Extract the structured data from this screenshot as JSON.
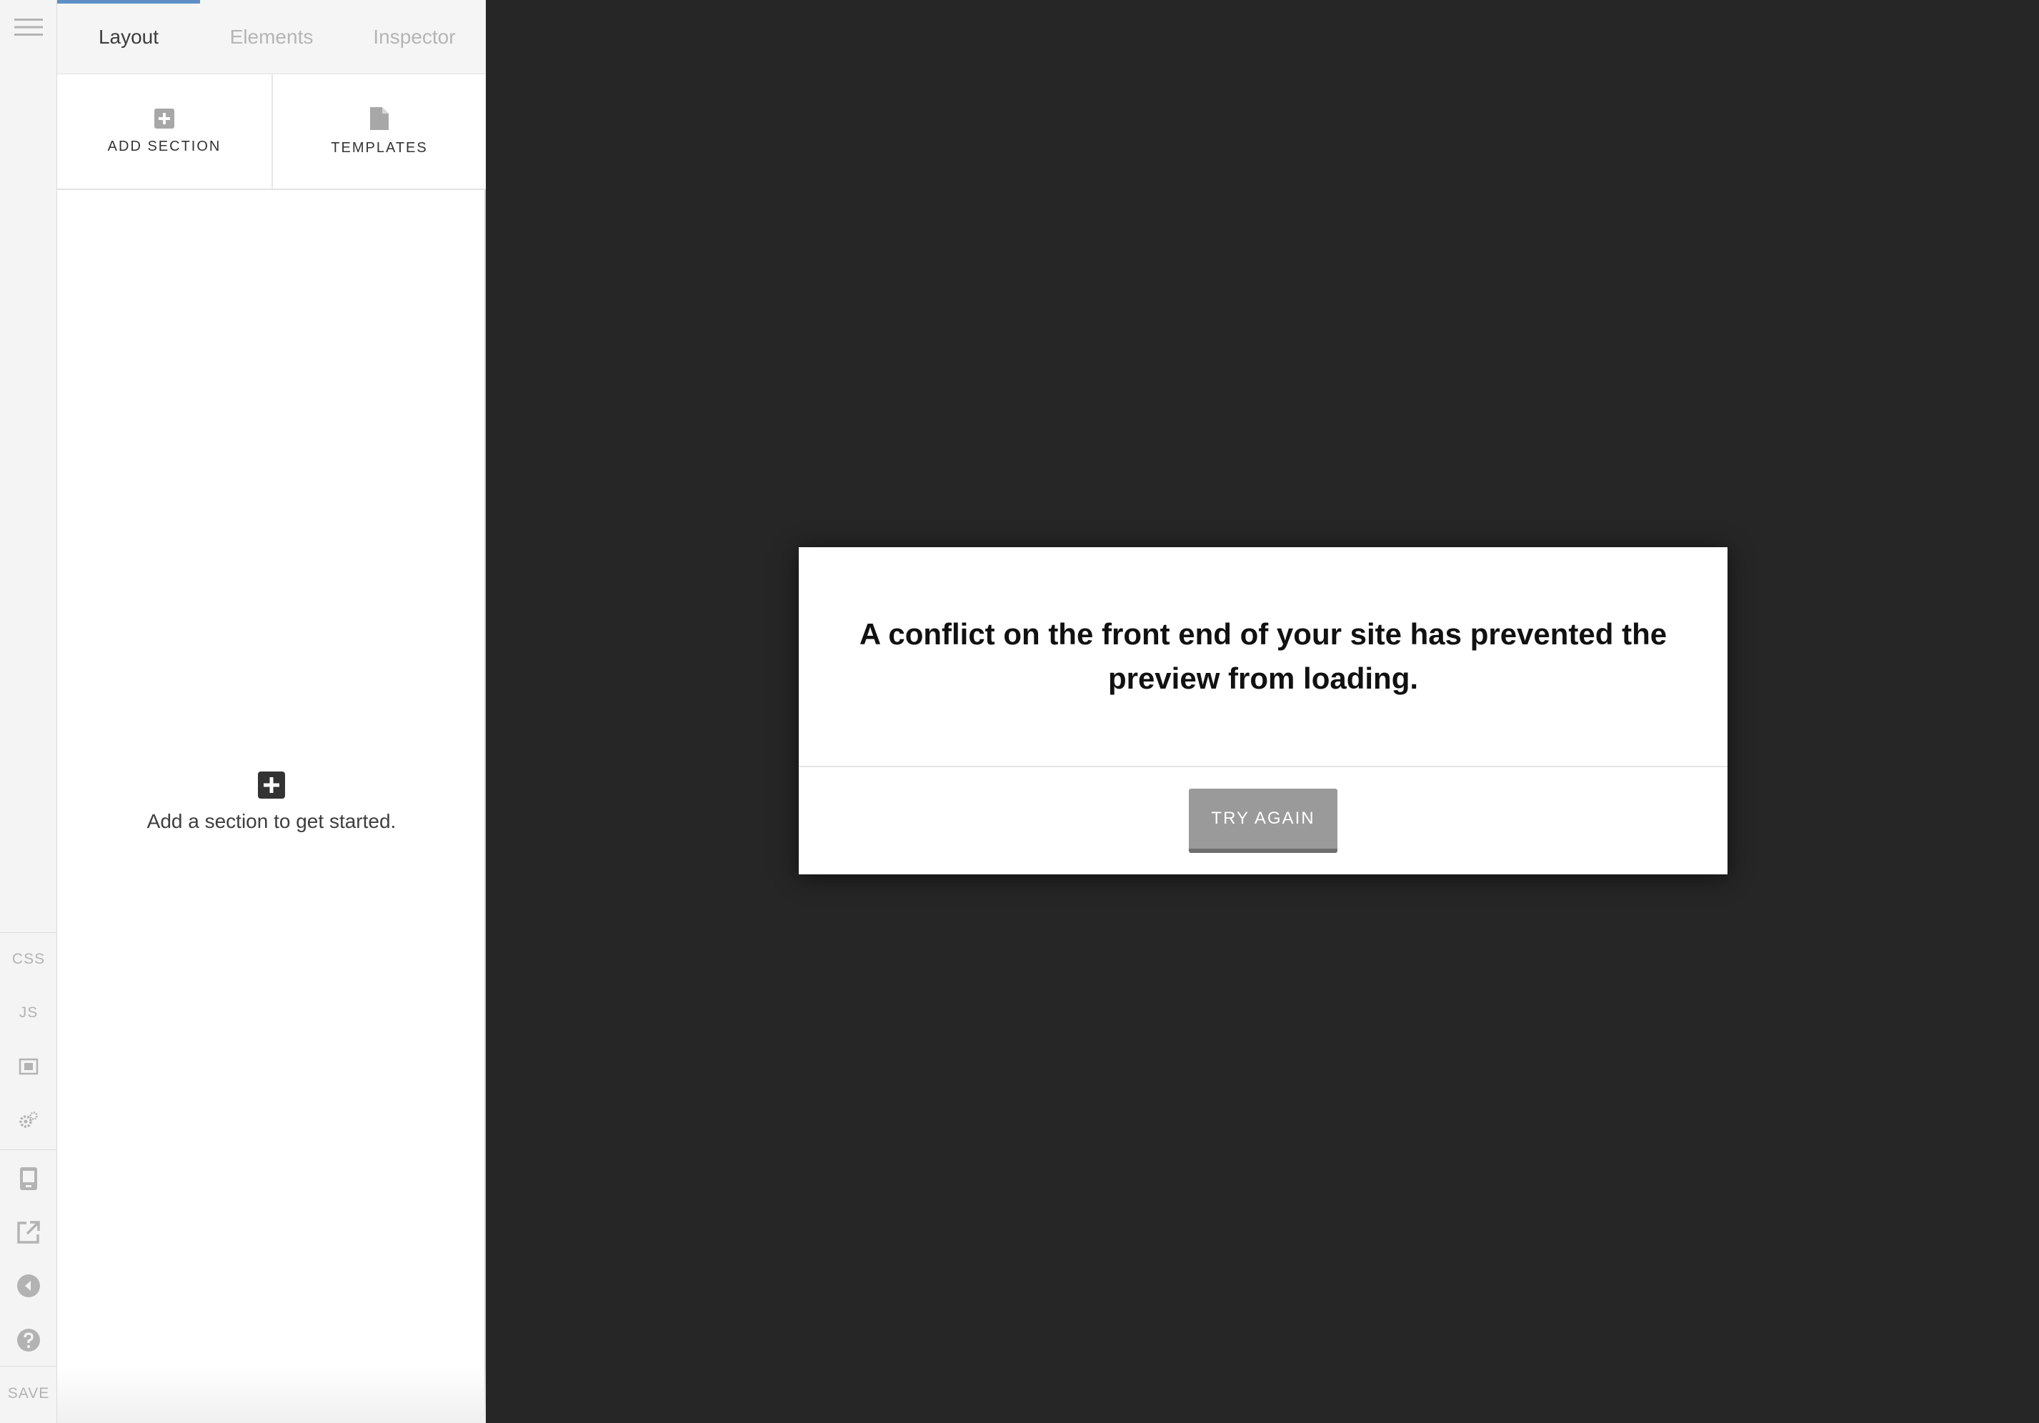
{
  "iconbar": {
    "top_items": [
      {
        "icon": "menu-icon"
      }
    ],
    "tool_items": [
      {
        "label": "CSS"
      },
      {
        "label": "JS"
      },
      {
        "icon": "image-frame-icon"
      },
      {
        "icon": "gears-icon"
      }
    ],
    "view_items": [
      {
        "icon": "responsive-device-icon"
      },
      {
        "icon": "external-link-icon"
      },
      {
        "icon": "back-arrow-icon"
      },
      {
        "icon": "help-icon"
      }
    ],
    "save_label": "SAVE"
  },
  "panel": {
    "tabs": [
      {
        "label": "Layout",
        "active": true
      },
      {
        "label": "Elements",
        "active": false
      },
      {
        "label": "Inspector",
        "active": false
      }
    ],
    "actions": [
      {
        "label": "ADD SECTION",
        "icon": "plus-square-icon"
      },
      {
        "label": "TEMPLATES",
        "icon": "document-icon"
      }
    ],
    "empty_state": {
      "icon": "plus-square-icon",
      "text": "Add a section to get started."
    }
  },
  "modal": {
    "message": "A conflict on the front end of your site has prevented the preview from loading.",
    "button_label": "TRY AGAIN"
  },
  "colors": {
    "preview_bg": "#262626",
    "tab_active_indicator": "#5e8fc4",
    "button_bg": "#9a9a9a"
  }
}
